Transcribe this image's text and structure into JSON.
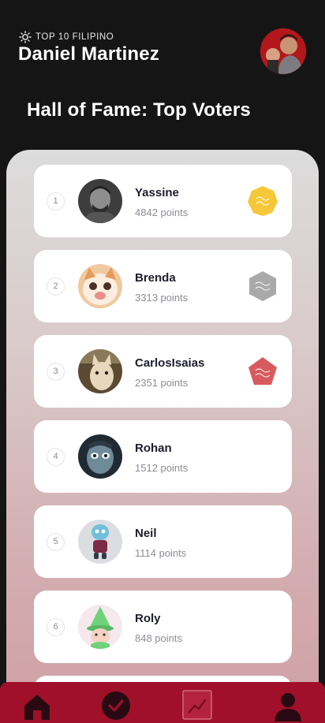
{
  "header": {
    "rank_tag": "TOP 10 FILIPINO",
    "user_name": "Daniel Martinez"
  },
  "page_title": "Hall of Fame: Top Voters",
  "voters": [
    {
      "rank": "1",
      "name": "Yassine",
      "points": "4842 points",
      "badge": "gold-badge-icon"
    },
    {
      "rank": "2",
      "name": "Brenda",
      "points": "3313 points",
      "badge": "silver-badge-icon"
    },
    {
      "rank": "3",
      "name": "CarlosIsaias",
      "points": "2351 points",
      "badge": "bronze-badge-icon"
    },
    {
      "rank": "4",
      "name": "Rohan",
      "points": "1512 points"
    },
    {
      "rank": "5",
      "name": "Neil",
      "points": "1114 points"
    },
    {
      "rank": "6",
      "name": "Roly",
      "points": "848 points"
    }
  ],
  "nav": {
    "items": [
      "home-icon",
      "check-circle-icon",
      "trending-icon",
      "profile-icon"
    ],
    "active": "trending-icon"
  },
  "colors": {
    "background": "#151515",
    "nav_background": "#a0102a",
    "gold": "#f5c83a",
    "silver": "#a9a9a9",
    "bronze": "#d75a5e"
  }
}
